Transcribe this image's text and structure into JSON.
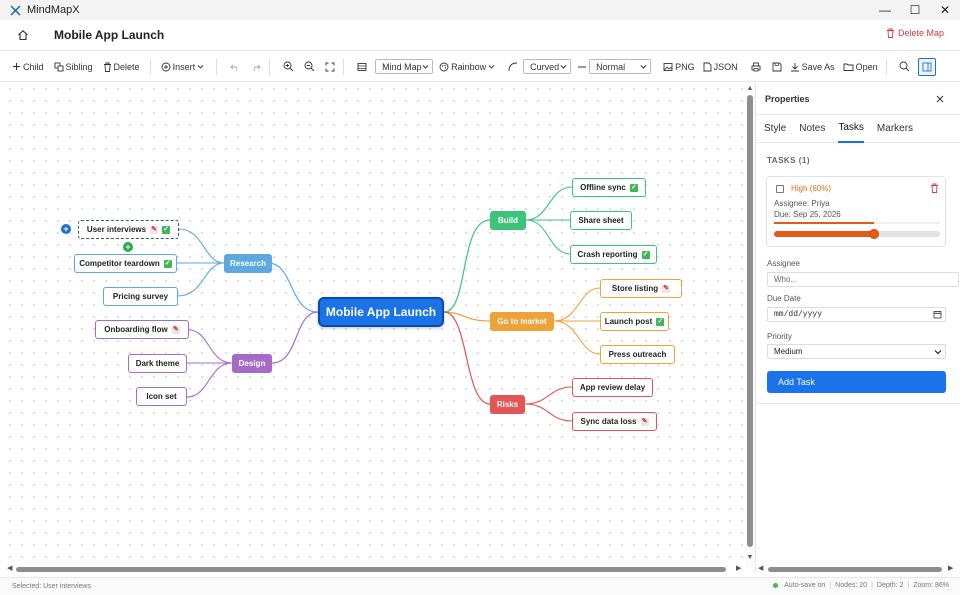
{
  "window": {
    "app_title": "MindMapX",
    "minimize": "—",
    "maximize": "☐",
    "close": "✕"
  },
  "header": {
    "doc_title": "Mobile App Launch",
    "delete_map": "Delete Map"
  },
  "toolbar": {
    "child": "Child",
    "sibling": "Sibling",
    "delete": "Delete",
    "insert": "Insert",
    "layout_select": "Mind Map",
    "theme": "Rainbow",
    "edge_select": "Curved",
    "weight_select": "Normal",
    "png": "PNG",
    "json": "JSON",
    "save_as": "Save As",
    "open": "Open"
  },
  "map": {
    "root": "Mobile App Launch",
    "branches": [
      {
        "key": "research",
        "label": "Research",
        "color": "#5ca8df"
      },
      {
        "key": "design",
        "label": "Design",
        "color": "#a66bc9"
      },
      {
        "key": "build",
        "label": "Build",
        "color": "#3ec47a"
      },
      {
        "key": "market",
        "label": "Go to market",
        "color": "#f0a23a"
      },
      {
        "key": "risks",
        "label": "Risks",
        "color": "#e35454"
      }
    ],
    "nodes": {
      "user_interviews": "User interviews",
      "competitor_teardown": "Competitor teardown",
      "pricing_survey": "Pricing survey",
      "onboarding_flow": "Onboarding flow",
      "dark_theme": "Dark theme",
      "icon_set": "Icon set",
      "offline_sync": "Offline sync",
      "share_sheet": "Share sheet",
      "crash_reporting": "Crash reporting",
      "store_listing": "Store listing",
      "launch_post": "Launch post",
      "press_outreach": "Press outreach",
      "app_review_delay": "App review delay",
      "sync_data_loss": "Sync data loss"
    }
  },
  "panel": {
    "title": "Properties",
    "tabs": [
      "Style",
      "Notes",
      "Tasks",
      "Markers"
    ],
    "active_tab": "Tasks",
    "section": "TASKS (1)",
    "task": {
      "priority": "High (60%)",
      "assignee": "Assignee: Priya",
      "due": "Due: Sep 25, 2026",
      "progress": 0.6
    },
    "assignee_label": "Assignee",
    "assignee_placeholder": "Who...",
    "due_label": "Due Date",
    "due_placeholder": "mm/dd/yyyy",
    "priority_label": "Priority",
    "priority_value": "Medium",
    "add_task": "Add Task"
  },
  "status": {
    "selected": "Selected: User interviews",
    "autosave": "Auto-save on",
    "nodes": "Nodes: 20",
    "depth": "Depth: 2",
    "zoom": "Zoom: 86%",
    "separator": "|"
  }
}
